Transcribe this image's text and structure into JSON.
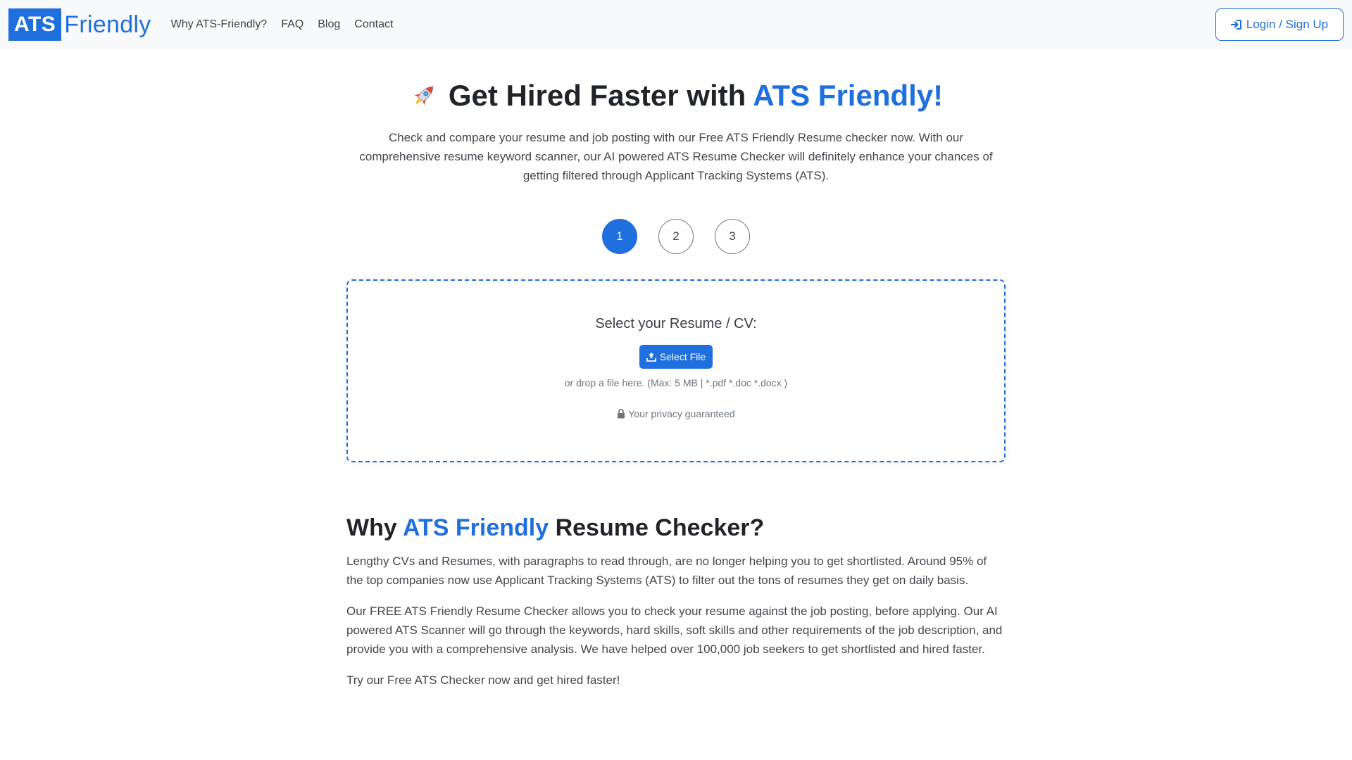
{
  "header": {
    "logo_ats": "ATS",
    "logo_friendly": "Friendly",
    "nav": [
      {
        "label": "Why ATS-Friendly?"
      },
      {
        "label": "FAQ"
      },
      {
        "label": "Blog"
      },
      {
        "label": "Contact"
      }
    ],
    "login_label": "Login / Sign Up"
  },
  "hero": {
    "title_prefix": "Get Hired Faster with ",
    "title_accent": "ATS Friendly!",
    "subtitle": "Check and compare your resume and job posting with our Free ATS Friendly Resume checker now. With our comprehensive resume keyword scanner, our AI powered ATS Resume Checker will definitely enhance your chances of getting filtered through Applicant Tracking Systems (ATS)."
  },
  "steps": [
    "1",
    "2",
    "3"
  ],
  "active_step": "1",
  "upload": {
    "label": "Select your Resume / CV:",
    "button": "Select File",
    "hint": "or drop a file here. (Max: 5 MB | *.pdf *.doc *.docx )",
    "privacy": "Your privacy guaranteed"
  },
  "why": {
    "title_prefix": "Why ",
    "title_accent": "ATS Friendly",
    "title_suffix": " Resume Checker?",
    "paragraphs": [
      "Lengthy CVs and Resumes, with paragraphs to read through, are no longer helping you to get shortlisted. Around 95% of the top companies now use Applicant Tracking Systems (ATS) to filter out the tons of resumes they get on daily basis.",
      "Our FREE ATS Friendly Resume Checker allows you to check your resume against the job posting, before applying. Our AI powered ATS Scanner will go through the keywords, hard skills, soft skills and other requirements of the job description, and provide you with a comprehensive analysis. We have helped over 100,000 job seekers to get shortlisted and hired faster.",
      "Try our Free ATS Checker now and get hired faster!"
    ]
  },
  "colors": {
    "accent": "#1f6fde",
    "header_bg": "#f8f9fa"
  },
  "icons": {
    "hero": "rocket-icon",
    "login": "sign-in-icon",
    "upload": "upload-icon",
    "privacy": "lock-icon"
  }
}
